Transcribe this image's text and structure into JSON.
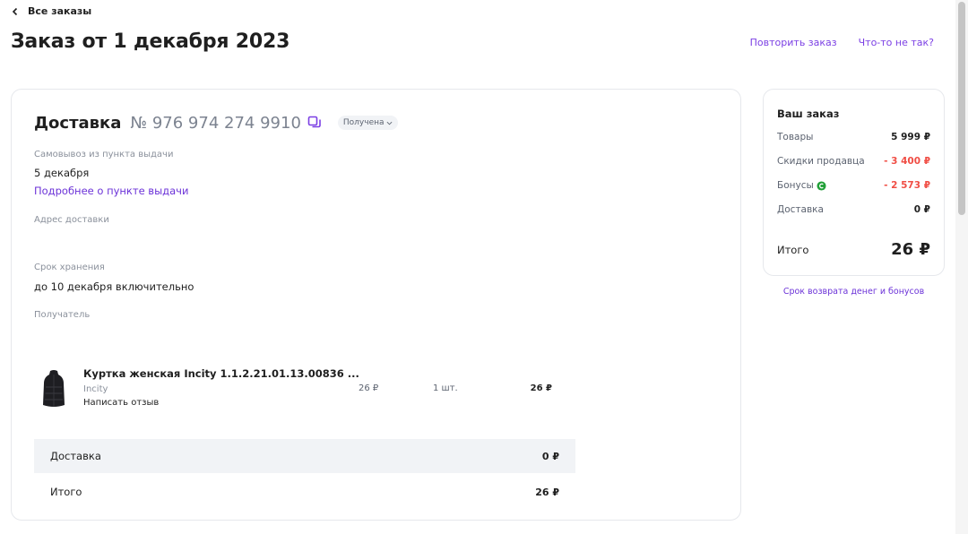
{
  "nav": {
    "back_label": "Все заказы"
  },
  "page": {
    "title": "Заказ от 1 декабря 2023"
  },
  "actions": {
    "repeat_label": "Повторить заказ",
    "problem_label": "Что-то не так?"
  },
  "delivery": {
    "title": "Доставка",
    "number": "№ 976 974 274 9910",
    "status": "Получена",
    "pickup_label": "Самовывоз из пункта выдачи",
    "pickup_date": "5 декабря",
    "pickup_link": "Подробнее о пункте выдачи",
    "address_label": "Адрес доставки",
    "storage_label": "Срок хранения",
    "storage_value": "до 10 декабря включительно",
    "recipient_label": "Получатель"
  },
  "item": {
    "name": "Куртка женская Incity 1.1.2.21.01.13.00836 ...",
    "brand": "Incity",
    "review_link": "Написать отзыв",
    "price": "26 ₽",
    "qty": "1 шт.",
    "sum": "26 ₽"
  },
  "totals": {
    "delivery_label": "Доставка",
    "delivery_value": "0 ₽",
    "total_label": "Итого",
    "total_value": "26 ₽"
  },
  "summary": {
    "title": "Ваш заказ",
    "goods_label": "Товары",
    "goods_value": "5 999 ₽",
    "discount_label": "Скидки продавца",
    "discount_value": "- 3 400 ₽",
    "bonus_label": "Бонусы",
    "bonus_value": "- 2 573 ₽",
    "delivery_label": "Доставка",
    "delivery_value": "0 ₽",
    "total_label": "Итого",
    "total_value": "26 ₽"
  },
  "refund_link": "Срок возврата денег и бонусов",
  "colors": {
    "accent": "#7b3fe4",
    "discount": "#f04e45",
    "bonus": "#21a038",
    "grey_bg": "#f1f3f6"
  },
  "icons": {
    "back": "chevron-left-icon",
    "copy": "copy-icon",
    "status": "chevron-down-icon",
    "bonus": "bonus-icon"
  }
}
